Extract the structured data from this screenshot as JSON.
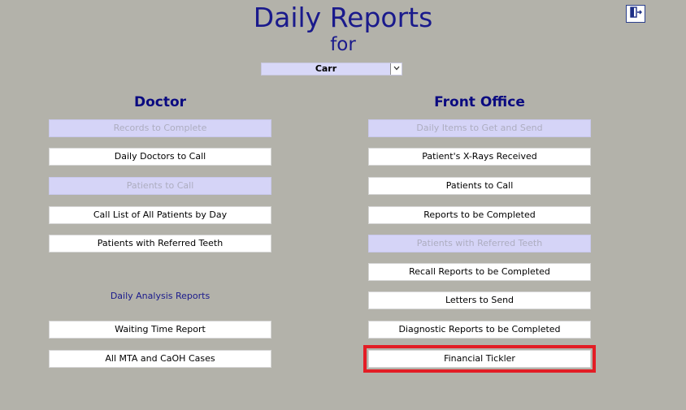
{
  "header": {
    "title": "Daily Reports",
    "subtitle": "for"
  },
  "doctor_select": {
    "value": "Carr"
  },
  "icons": {
    "exit": "exit-door-icon",
    "dropdown": "chevron-down-icon"
  },
  "doctor": {
    "heading": "Doctor",
    "buttons": [
      {
        "label": "Records to Complete"
      },
      {
        "label": "Daily Doctors to Call"
      },
      {
        "label": "Patients to Call"
      },
      {
        "label": "Call List of All Patients by Day"
      },
      {
        "label": "Patients with Referred Teeth"
      }
    ],
    "analysis_label": "Daily Analysis Reports",
    "analysis_buttons": [
      {
        "label": "Waiting Time Report"
      },
      {
        "label": "All MTA and CaOH Cases"
      }
    ]
  },
  "front_office": {
    "heading": "Front Office",
    "buttons": [
      {
        "label": "Daily Items to Get and Send"
      },
      {
        "label": "Patient's X-Rays Received"
      },
      {
        "label": "Patients to Call"
      },
      {
        "label": "Reports to be Completed"
      },
      {
        "label": "Patients with Referred Teeth"
      },
      {
        "label": "Recall Reports to be Completed"
      },
      {
        "label": "Letters to Send"
      },
      {
        "label": "Diagnostic Reports to be Completed"
      },
      {
        "label": "Financial Tickler"
      }
    ]
  },
  "colors": {
    "background": "#b3b2aa",
    "heading": "#0a0a80",
    "disabled_button": "#d5d4f7",
    "highlight": "#e31d25"
  }
}
